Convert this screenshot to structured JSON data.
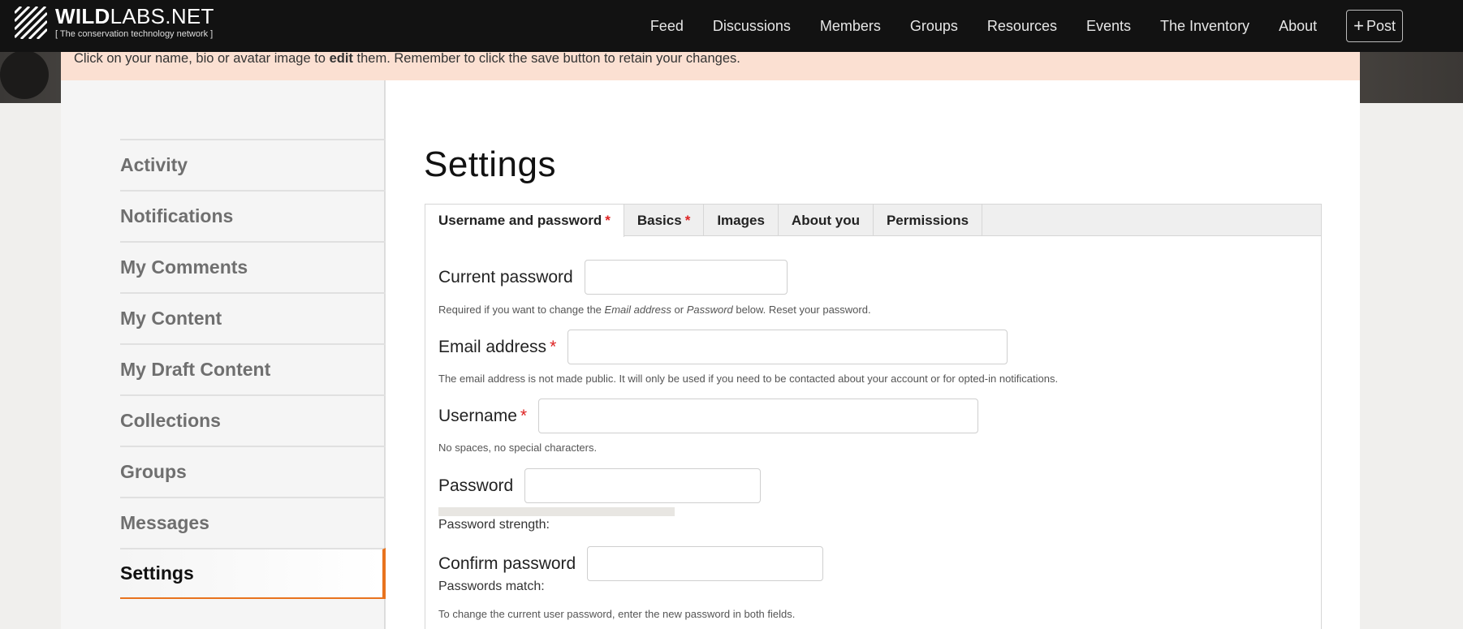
{
  "brand": {
    "name_bold": "WILD",
    "name_rest": "LABS.NET",
    "tagline": "[ The conservation technology network ]"
  },
  "nav": {
    "items": [
      "Feed",
      "Discussions",
      "Members",
      "Groups",
      "Resources",
      "Events",
      "The Inventory",
      "About"
    ],
    "post_label": "Post"
  },
  "notice": {
    "before": "Click on your name, bio or avatar image to ",
    "bold": "edit",
    "after": " them. Remember to click the save button to retain your changes."
  },
  "sidebar": {
    "items": [
      "Activity",
      "Notifications",
      "My Comments",
      "My Content",
      "My Draft Content",
      "Collections",
      "Groups",
      "Messages",
      "Settings"
    ],
    "active": "Settings"
  },
  "page": {
    "title": "Settings"
  },
  "tabs": [
    {
      "label": "Username and password",
      "required": true
    },
    {
      "label": "Basics",
      "required": true
    },
    {
      "label": "Images",
      "required": false
    },
    {
      "label": "About you",
      "required": false
    },
    {
      "label": "Permissions",
      "required": false
    }
  ],
  "required_mark": "*",
  "form": {
    "current_password": {
      "label": "Current password",
      "help_prefix": "Required if you want to change the ",
      "help_em1": "Email address",
      "help_mid": " or ",
      "help_em2": "Password",
      "help_suffix": " below. Reset your password."
    },
    "email": {
      "label": "Email address",
      "help": "The email address is not made public. It will only be used if you need to be contacted about your account or for opted-in notifications."
    },
    "username": {
      "label": "Username",
      "help": "No spaces, no special characters."
    },
    "password": {
      "label": "Password",
      "strength_label": "Password strength:"
    },
    "confirm_password": {
      "label": "Confirm password",
      "match_label": "Passwords match:"
    },
    "password_help": "To change the current user password, enter the new password in both fields."
  },
  "colors": {
    "accent": "#e8731e",
    "notice_bg": "#fbe0d2",
    "topbar_bg": "#121212",
    "required": "#dd2222"
  }
}
